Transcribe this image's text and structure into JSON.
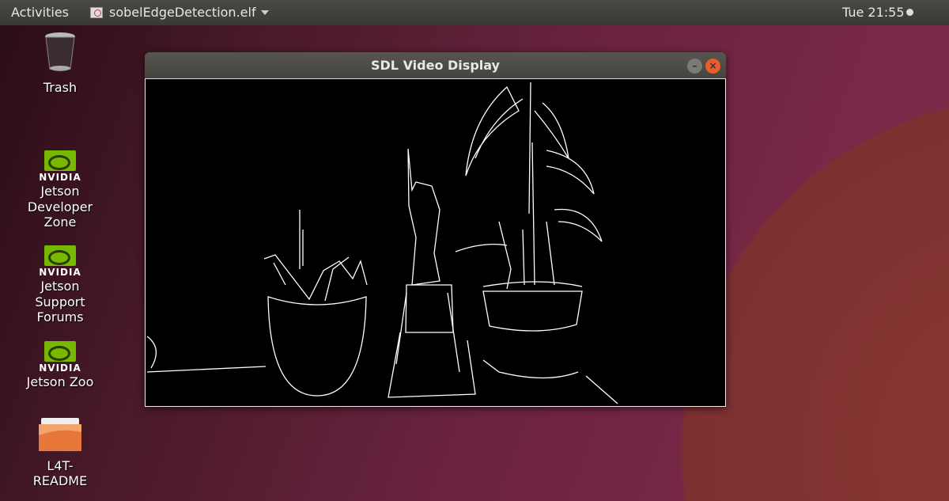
{
  "topbar": {
    "activities": "Activities",
    "app_name": "sobelEdgeDetection.elf",
    "clock": "Tue 21:55"
  },
  "desktop": {
    "icons": [
      {
        "label": "Trash",
        "icon": "trash-icon"
      },
      {
        "brand": "NVIDIA",
        "label_lines": [
          "Jetson",
          "Developer",
          "Zone"
        ],
        "icon": "nvidia-icon"
      },
      {
        "brand": "NVIDIA",
        "label_lines": [
          "Jetson",
          "Support",
          "Forums"
        ],
        "icon": "nvidia-icon"
      },
      {
        "brand": "NVIDIA",
        "label_lines": [
          "Jetson Zoo"
        ],
        "icon": "nvidia-icon"
      },
      {
        "label_lines": [
          "L4T-",
          "README"
        ],
        "icon": "folder-icon"
      }
    ]
  },
  "window": {
    "title": "SDL Video Display",
    "minimize": "–",
    "close": "×"
  },
  "colors": {
    "accent_close": "#e85e2a",
    "nvidia_green": "#76b900"
  }
}
